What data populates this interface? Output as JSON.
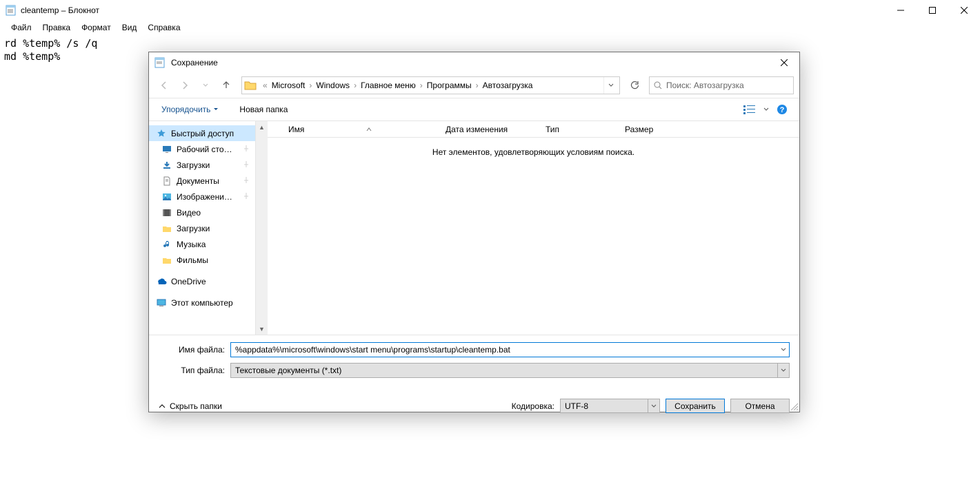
{
  "notepad": {
    "title": "cleantemp – Блокнот",
    "menu": [
      "Файл",
      "Правка",
      "Формат",
      "Вид",
      "Справка"
    ],
    "body": "rd %temp% /s /q\nmd %temp%"
  },
  "dialog": {
    "title": "Сохранение",
    "breadcrumb_prefix": "«",
    "breadcrumb": [
      "Microsoft",
      "Windows",
      "Главное меню",
      "Программы",
      "Автозагрузка"
    ],
    "search_placeholder": "Поиск: Автозагрузка",
    "organize": "Упорядочить",
    "new_folder": "Новая папка",
    "columns": {
      "name": "Имя",
      "date": "Дата изменения",
      "type": "Тип",
      "size": "Размер"
    },
    "empty_msg": "Нет элементов, удовлетворяющих условиям поиска.",
    "tree": {
      "quick": "Быстрый доступ",
      "items": [
        {
          "label": "Рабочий сто…",
          "icon": "desktop",
          "pin": true
        },
        {
          "label": "Загрузки",
          "icon": "down",
          "pin": true
        },
        {
          "label": "Документы",
          "icon": "doc",
          "pin": true
        },
        {
          "label": "Изображени…",
          "icon": "pic",
          "pin": true
        },
        {
          "label": "Видео",
          "icon": "vid",
          "pin": false
        },
        {
          "label": "Загрузки",
          "icon": "folder",
          "pin": false
        },
        {
          "label": "Музыка",
          "icon": "music",
          "pin": false
        },
        {
          "label": "Фильмы",
          "icon": "folder",
          "pin": false
        }
      ],
      "onedrive": "OneDrive",
      "thispc": "Этот компьютер"
    },
    "filename_label": "Имя файла:",
    "filename_value": "%appdata%\\microsoft\\windows\\start menu\\programs\\startup\\cleantemp.bat",
    "filetype_label": "Тип файла:",
    "filetype_value": "Текстовые документы (*.txt)",
    "hide_folders": "Скрыть папки",
    "encoding_label": "Кодировка:",
    "encoding_value": "UTF-8",
    "save": "Сохранить",
    "cancel": "Отмена"
  }
}
